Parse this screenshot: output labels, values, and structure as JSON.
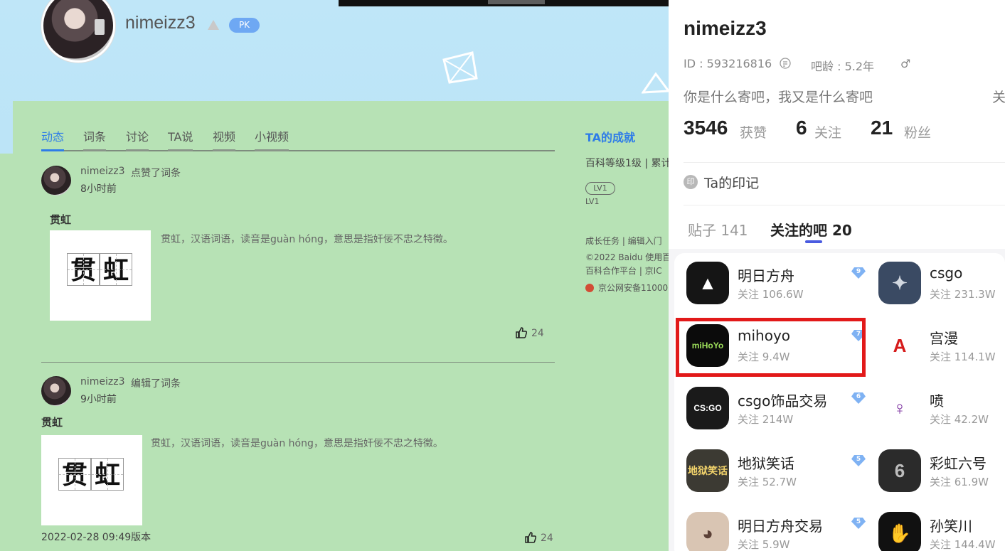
{
  "left": {
    "username": "nimeizz3",
    "pk_badge": "PK",
    "tabs": [
      "动态",
      "词条",
      "讨论",
      "TA说",
      "视频",
      "小视频"
    ],
    "feed": [
      {
        "user": "nimeizz3",
        "action": "点赞了词条",
        "time": "8小时前",
        "title": "贯虹",
        "thumb_chars": [
          "贯",
          "虹"
        ],
        "desc": "贯虹，汉语词语，读音是guàn hóng，意思是指奸佞不忠之特徵。",
        "likes": "24"
      },
      {
        "user": "nimeizz3",
        "action": "编辑了词条",
        "time": "9小时前",
        "title": "贯虹",
        "thumb_chars": [
          "贯",
          "虹"
        ],
        "desc": "贯虹，汉语词语，读音是guàn hóng，意思是指奸佞不忠之特徵。",
        "likes": "24",
        "version": "2022-02-28 09:49版本"
      }
    ],
    "side": {
      "achievements": "TA的成就",
      "level_text": "百科等级1级 | 累计",
      "lv_pill": "LV1",
      "lv_small": "LV1",
      "links": "成长任务 | 编辑入门",
      "copyright": "©2022 Baidu 使用百",
      "platform": "百科合作平台 | 京IC",
      "police": "京公网安备11000"
    }
  },
  "right": {
    "name": "nimeizz3",
    "id_text": "ID : 593216816",
    "age_text": "吧龄 : 5.2年",
    "gender": "♂",
    "bio": "你是什么寄吧，我又是什么寄吧",
    "bio_more": "关",
    "stats": [
      {
        "num": "3546",
        "label": "获赞"
      },
      {
        "num": "6",
        "label": "关注"
      },
      {
        "num": "21",
        "label": "粉丝"
      }
    ],
    "mark_icon": "印",
    "mark": "Ta的印记",
    "tab_posts": "贴子 141",
    "tab_bars": "关注的吧 20",
    "bars": [
      {
        "name": "明日方舟",
        "followers": "关注 106.6W",
        "level": "9",
        "icon_bg": "#151515",
        "icon_fg": "#fff",
        "icon_text": "▲"
      },
      {
        "name": "csgo",
        "followers": "关注 231.3W",
        "level": "",
        "icon_bg": "#3a4a63",
        "icon_fg": "#d2d8e0",
        "icon_text": "✦"
      },
      {
        "name": "mihoyo",
        "followers": "关注 9.4W",
        "level": "7",
        "icon_bg": "#0b0b0b",
        "icon_fg": "#9ee05b",
        "icon_text": "miHoYo"
      },
      {
        "name": "宫漫",
        "followers": "关注 114.1W",
        "level": "",
        "icon_bg": "#ffffff",
        "icon_fg": "#d61b1b",
        "icon_text": "A"
      },
      {
        "name": "csgo饰品交易",
        "followers": "关注 214W",
        "level": "6",
        "icon_bg": "#1a1a1a",
        "icon_fg": "#ffffff",
        "icon_text": "CS:GO"
      },
      {
        "name": "喷",
        "followers": "关注 42.2W",
        "level": "",
        "icon_bg": "#ffffff",
        "icon_fg": "#7a2d9e",
        "icon_text": "♀"
      },
      {
        "name": "地狱笑话",
        "followers": "关注 52.7W",
        "level": "5",
        "icon_bg": "#3c3a33",
        "icon_fg": "#f2d36b",
        "icon_text": "地狱笑话"
      },
      {
        "name": "彩虹六号",
        "followers": "关注 61.9W",
        "level": "",
        "icon_bg": "#2b2b2b",
        "icon_fg": "#bdbdbd",
        "icon_text": "6"
      },
      {
        "name": "明日方舟交易",
        "followers": "关注 5.9W",
        "level": "5",
        "icon_bg": "#d9c5b3",
        "icon_fg": "#5b4036",
        "icon_text": "◕"
      },
      {
        "name": "孙笑川",
        "followers": "关注 144.4W",
        "level": "",
        "icon_bg": "#111111",
        "icon_fg": "#ffffff",
        "icon_text": "✋"
      }
    ]
  }
}
